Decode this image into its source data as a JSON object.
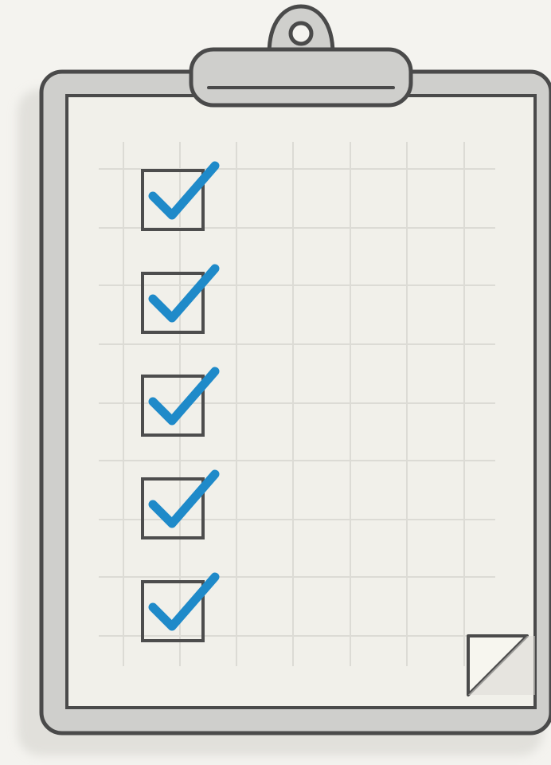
{
  "colors": {
    "background": "#f4f3ef",
    "board": "#cfcfcc",
    "board_outline": "#4a4a4a",
    "paper": "#f1f0ea",
    "grid": "#dcdbd5",
    "checkbox_outline": "#4d4d4d",
    "checkmark": "#1f8ac9",
    "clip": "#cfcfcc",
    "page_curl": "#f7f6ef"
  },
  "checklist": {
    "items": [
      {
        "checked": true
      },
      {
        "checked": true
      },
      {
        "checked": true
      },
      {
        "checked": true
      },
      {
        "checked": true
      }
    ]
  },
  "icons": {
    "clip": "clipboard-clip-icon",
    "check": "checkmark-icon",
    "curl": "page-curl-icon"
  }
}
